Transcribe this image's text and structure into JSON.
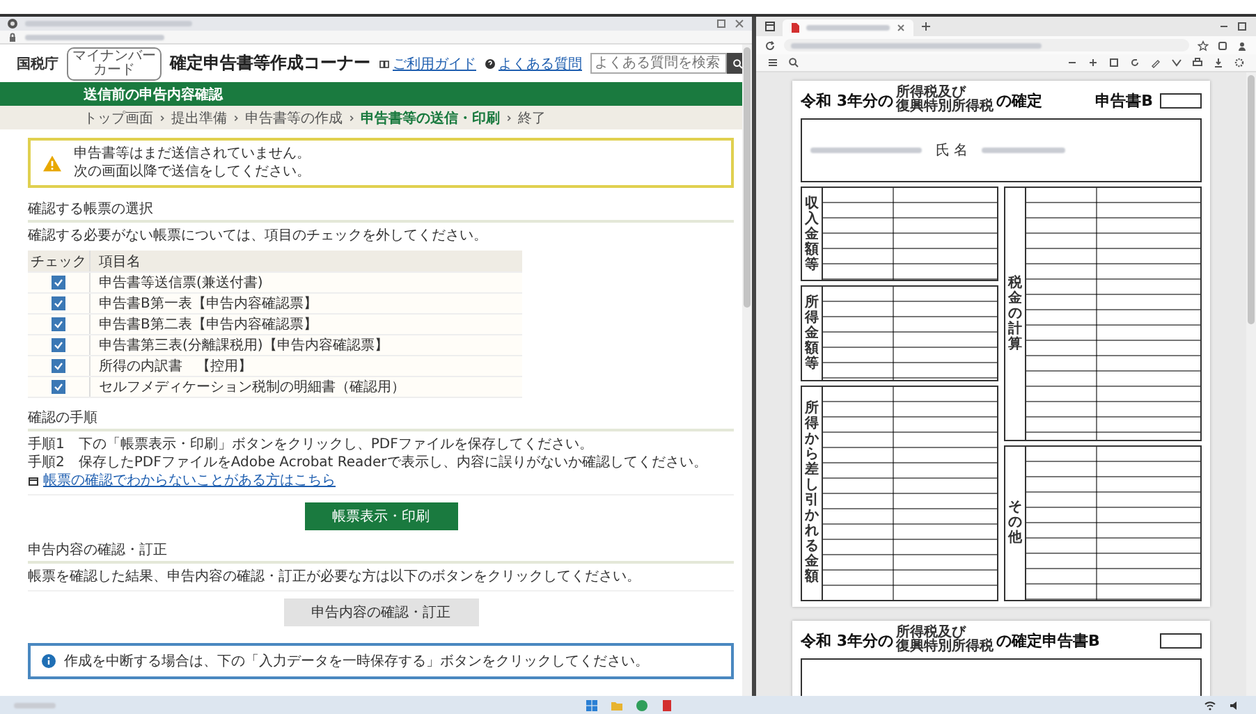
{
  "left_browser": {
    "site_header": {
      "logo": "国税庁",
      "badge": [
        "マイナンバー",
        "カード"
      ],
      "title": "確定申告書等作成コーナー",
      "guide_link": "ご利用ガイド",
      "faq_link": "よくある質問",
      "search_placeholder": "よくある質問を検索"
    },
    "page_title": "送信前の申告内容確認",
    "breadcrumb": [
      {
        "label": "トップ画面",
        "selected": false
      },
      {
        "label": "提出準備",
        "selected": false
      },
      {
        "label": "申告書等の作成",
        "selected": false
      },
      {
        "label": "申告書等の送信・印刷",
        "selected": true
      },
      {
        "label": "終了",
        "selected": false
      }
    ],
    "warning": {
      "lines": [
        "申告書等はまだ送信されていません。",
        "次の画面以降で送信をしてください。"
      ]
    },
    "form_selection": {
      "heading": "確認する帳票の選択",
      "instruction": "確認する必要がない帳票については、項目のチェックを外してください。",
      "columns": [
        "チェック",
        "項目名"
      ],
      "rows": [
        {
          "label": "申告書等送信票(兼送付書)",
          "checked": true
        },
        {
          "label": "申告書B第一表【申告内容確認票】",
          "checked": true
        },
        {
          "label": "申告書B第二表【申告内容確認票】",
          "checked": true
        },
        {
          "label": "申告書第三表(分離課税用)【申告内容確認票】",
          "checked": true
        },
        {
          "label": "所得の内訳書　【控用】",
          "checked": true
        },
        {
          "label": "セルフメディケーション税制の明細書（確認用）",
          "checked": true
        }
      ]
    },
    "procedure": {
      "heading": "確認の手順",
      "steps": [
        "手順1　下の「帳票表示・印刷」ボタンをクリックし、PDFファイルを保存してください。",
        "手順2　保存したPDFファイルをAdobe Acrobat Readerで表示し、内容に誤りがないか確認してください。"
      ],
      "help_link": "帳票の確認でわからないことがある方はこちら",
      "button": "帳票表示・印刷"
    },
    "correction": {
      "heading": "申告内容の確認・訂正",
      "text": "帳票を確認した結果、申告内容の確認・訂正が必要な方は以下のボタンをクリックしてください。",
      "button": "申告内容の確認・訂正"
    },
    "info_note": "作成を中断する場合は、下の「入力データを一時保存する」ボタンをクリックしてください。"
  },
  "pdf_viewer": {
    "page_1": {
      "title_prefix": "令和 3年分の",
      "title_small": [
        "所得税及び",
        "復興特別所得税"
      ],
      "title_suffix": "の確定",
      "form_name": "申告書B",
      "name_label": "氏 名",
      "left_sections": [
        "収入金額等",
        "所得金額等",
        "所得から差し引かれる金額"
      ],
      "right_sections": [
        "税金の計算",
        "その他"
      ]
    },
    "page_2": {
      "title_prefix": "令和 3年分の",
      "title_small": [
        "所得税及び",
        "復興特別所得税"
      ],
      "title_suffix": "の確定申告書B"
    }
  }
}
